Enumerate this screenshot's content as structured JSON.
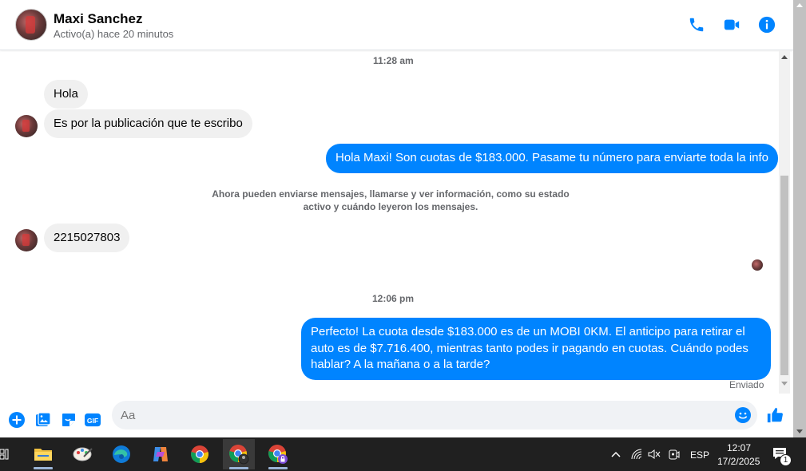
{
  "header": {
    "contact_name": "Maxi Sanchez",
    "status": "Activo(a) hace 20 minutos",
    "accent": "#0084ff"
  },
  "messages": {
    "time_1": "11:28 am",
    "in_1": "Hola",
    "in_2": "Es por la publicación que te escribo",
    "out_1": "Hola Maxi! Son cuotas de $183.000. Pasame tu número para enviarte toda la info",
    "notice": "Ahora pueden enviarse mensajes, llamarse y ver información, como su estado activo y cuándo leyeron los mensajes.",
    "in_3": "2215027803",
    "time_2": "12:06 pm",
    "out_2": "Perfecto! La cuota desde $183.000 es de un MOBI 0KM. El anticipo para retirar el auto es de $7.716.400, mientras tanto podes ir pagando en cuotas. Cuándo podes hablar? A la mañana o a la tarde?",
    "sent_label": "Enviado"
  },
  "composer": {
    "placeholder": "Aa"
  },
  "taskbar": {
    "language": "ESP",
    "time": "12:07",
    "date": "17/2/2025",
    "notification_count": "1"
  }
}
